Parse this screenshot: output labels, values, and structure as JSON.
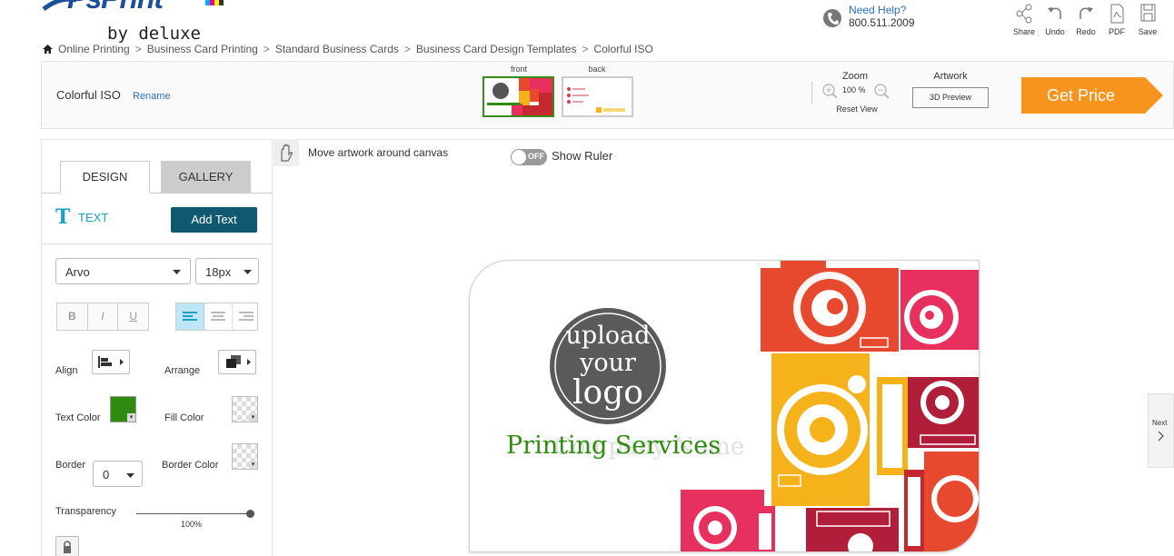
{
  "brand": {
    "name": "PsPrint",
    "sub": "by deluxe"
  },
  "breadcrumb": [
    "Online Printing",
    "Business Card Printing",
    "Standard Business Cards",
    "Business Card Design Templates",
    "Colorful ISO"
  ],
  "help": {
    "label": "Need Help?",
    "phone": "800.511.2009"
  },
  "toolbar": {
    "share": "Share",
    "undo": "Undo",
    "redo": "Redo",
    "pdf": "PDF",
    "save": "Save"
  },
  "design_bar": {
    "design_name": "Colorful ISO",
    "rename": "Rename",
    "front_label": "front",
    "back_label": "back",
    "zoom_label": "Zoom",
    "zoom_value": "100 %",
    "reset_view": "Reset View",
    "artwork_label": "Artwork",
    "preview_3d": "3D Preview",
    "get_price": "Get Price"
  },
  "left_panel": {
    "tabs": [
      "DESIGN",
      "GALLERY"
    ],
    "text_label": "TEXT",
    "add_text": "Add Text",
    "font": "Arvo",
    "font_size": "18px",
    "bold": "B",
    "italic": "I",
    "underline": "U",
    "align_label": "Align",
    "arrange_label": "Arrange",
    "text_color_label": "Text Color",
    "text_color": "#2e8b10",
    "fill_color_label": "Fill Color",
    "border_label": "Border",
    "border_value": "0",
    "border_color_label": "Border Color",
    "transparency_label": "Transparency",
    "transparency_value": "100%"
  },
  "canvas": {
    "move_hint": "Move artwork around canvas",
    "ruler_toggle": "OFF",
    "show_ruler": "Show Ruler",
    "logo_lines": [
      "upload",
      "your",
      "logo"
    ],
    "headline": "Printing Services",
    "ghost_text": "Company Name",
    "headline_color": "#2e8b10",
    "next": "Next"
  }
}
